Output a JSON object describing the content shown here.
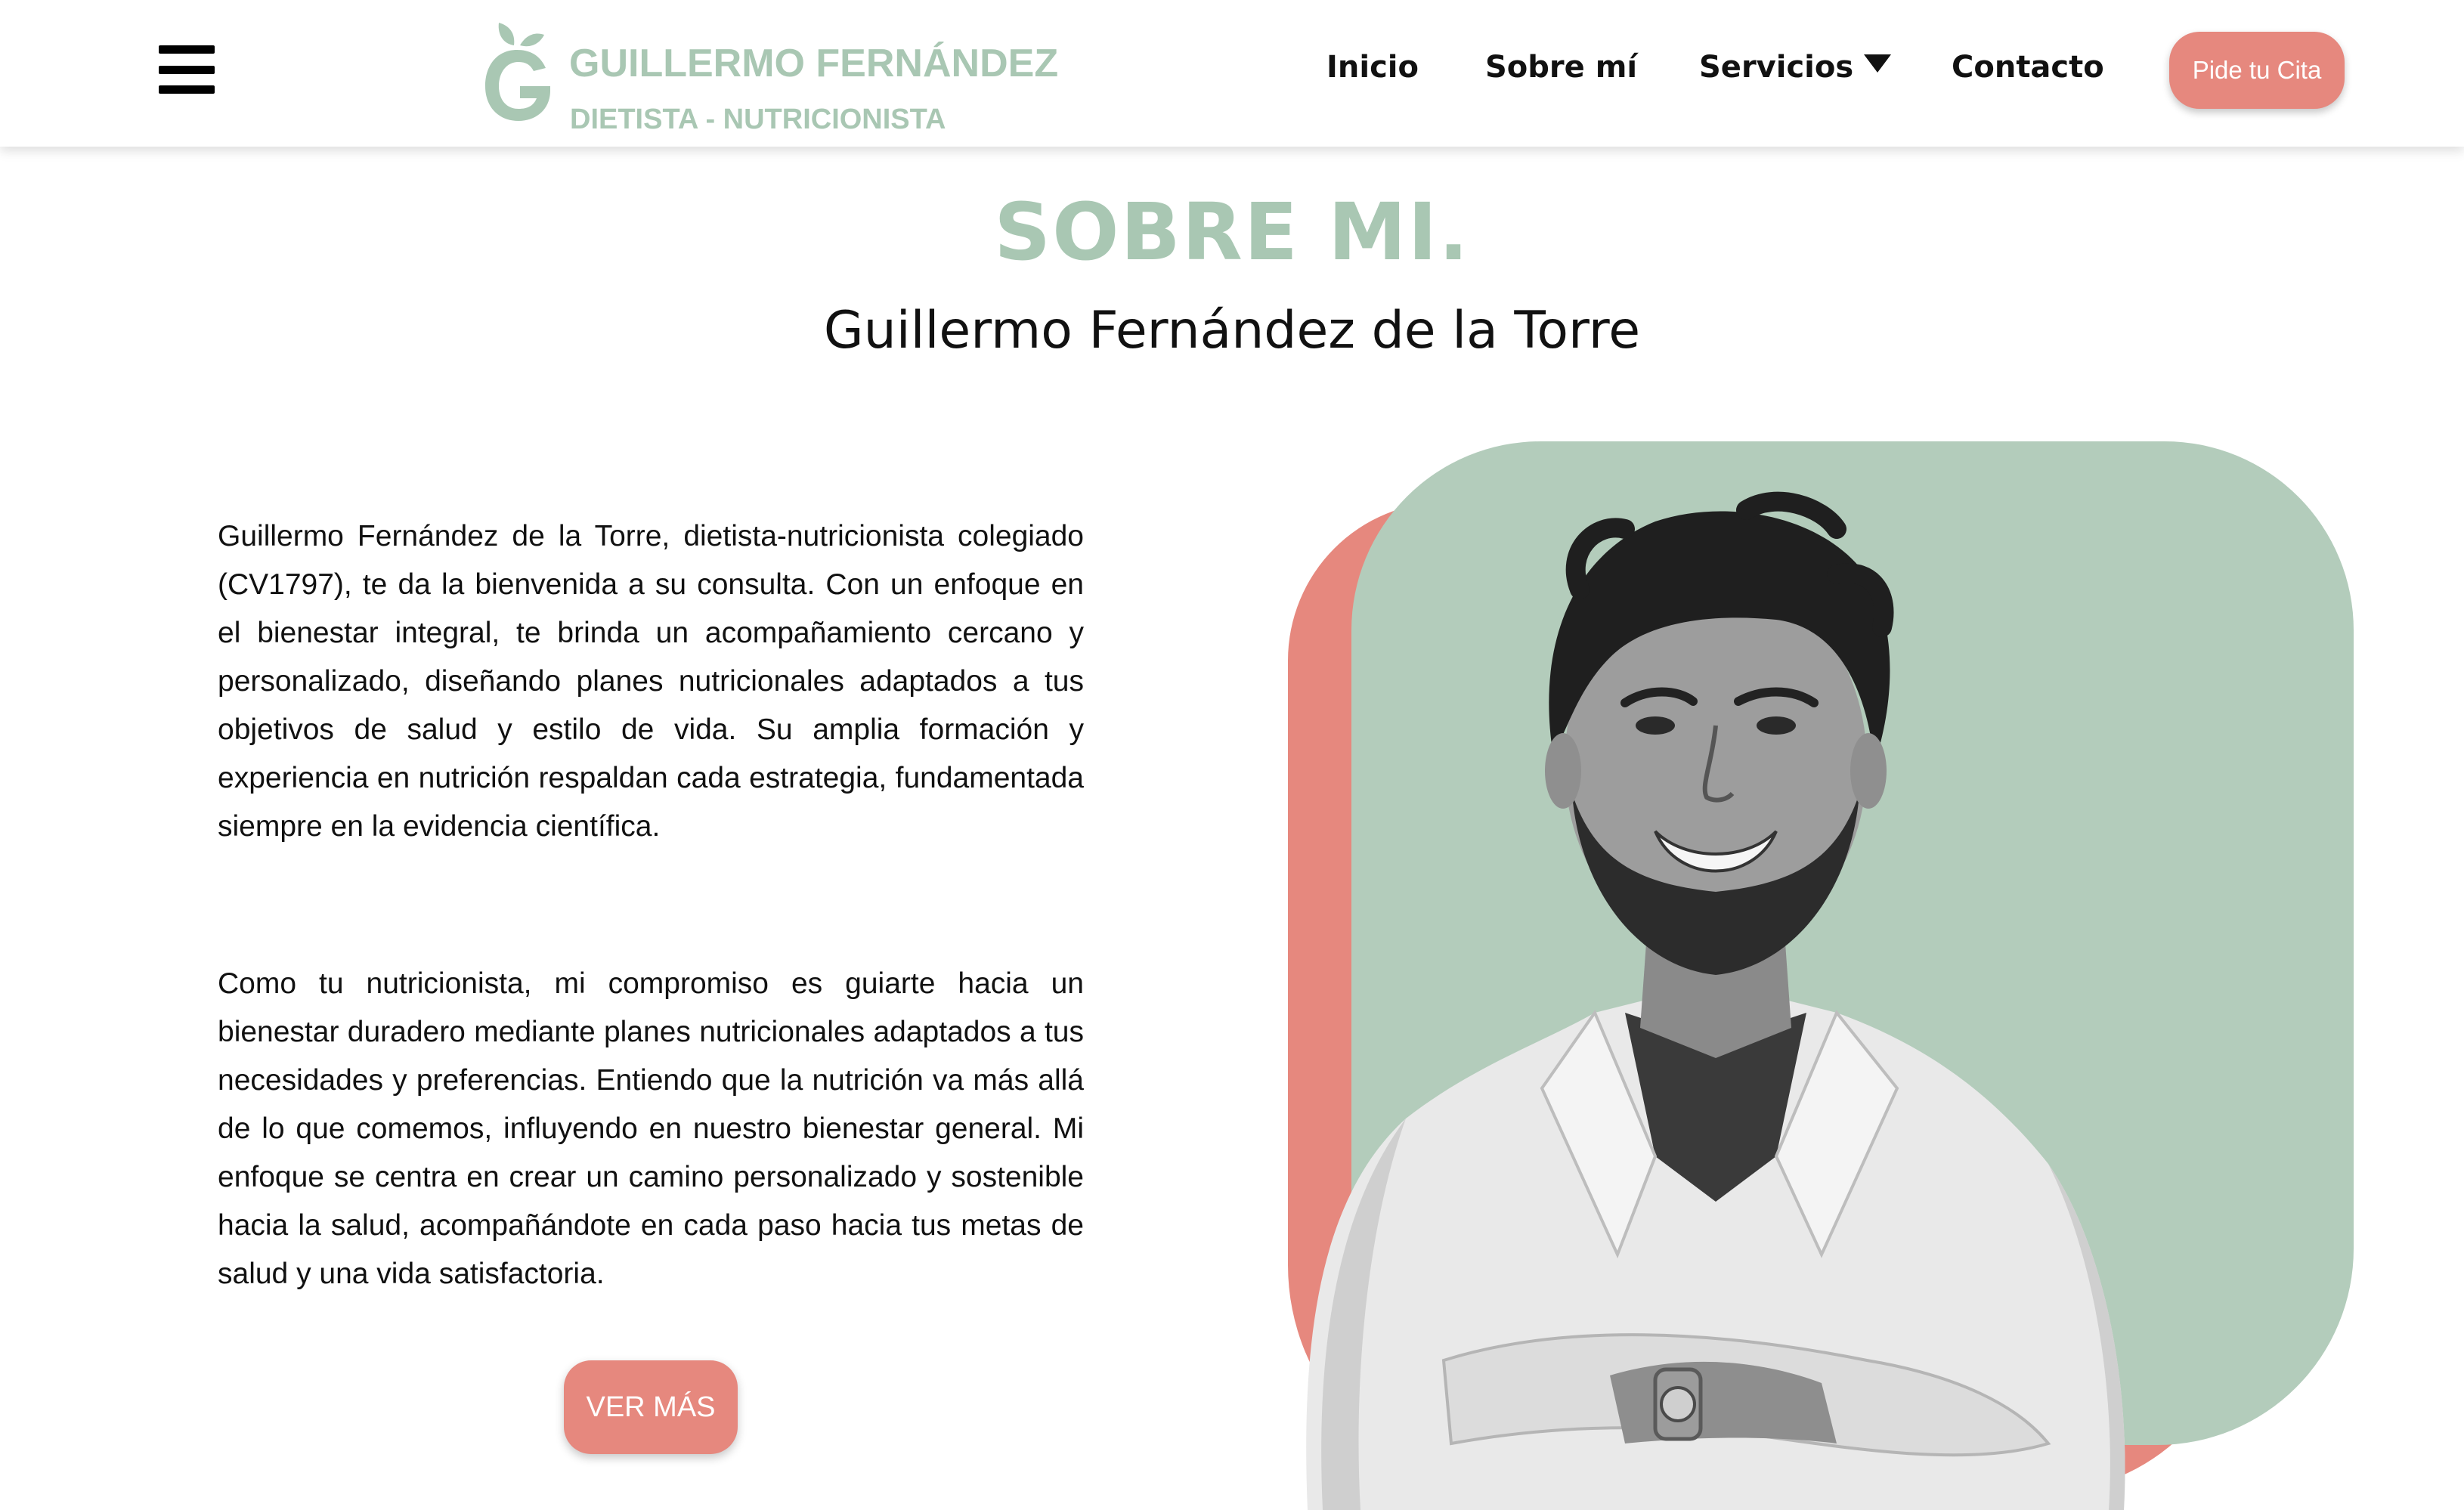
{
  "header": {
    "menu_icon": "hamburger-menu-icon",
    "logo": {
      "name": "GUILLERMO FERNÁNDEZ",
      "subtitle": "DIETISTA - NUTRICIONISTA",
      "mark_icon": "apple-g-logo-icon",
      "color": "#a9c7b3"
    },
    "nav": [
      {
        "label": "Inicio"
      },
      {
        "label": "Sobre mí"
      },
      {
        "label": "Servicios",
        "icon": "caret-down-icon"
      },
      {
        "label": "Contacto"
      }
    ],
    "cta_label": "Pide tu Cita"
  },
  "about": {
    "title": "SOBRE MI.",
    "subtitle": "Guillermo Fernández de la Torre",
    "paragraphs": [
      "Guillermo Fernández de la Torre, dietista-nutricionista colegiado (CV1797), te da la bienvenida a su consulta. Con un enfoque en el bienestar integral, te brinda un acompañamiento cercano y personalizado, diseñando planes nutricionales adaptados a tus objetivos de salud y estilo de vida. Su amplia formación y experiencia en nutrición respaldan cada estrategia, fundamentada siempre en la evidencia científica.",
      "Como tu nutricionista, mi compromiso es guiarte hacia un bienestar duradero mediante planes nutricionales adaptados a tus necesidades y preferencias. Entiendo que la nutrición va más allá de lo que comemos, influyendo en nuestro bienestar general. Mi enfoque se centra en crear un camino personalizado y sostenible hacia la salud, acompañándote en cada paso hacia tus metas de salud y una vida satisfactoria."
    ],
    "button_label": "VER MÁS"
  },
  "colors": {
    "accent_green": "#a9c7b3",
    "shape_green": "#b3ccbb",
    "coral": "#e6887e"
  }
}
